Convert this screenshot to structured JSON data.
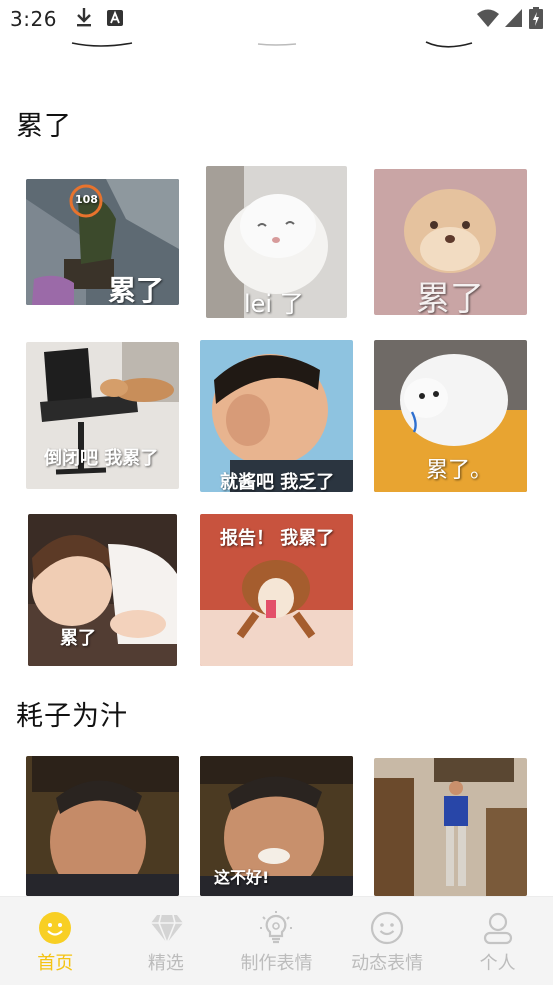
{
  "status_bar": {
    "time": "3:26",
    "icons": [
      "download-icon",
      "text-a-icon",
      "wifi-icon",
      "signal-icon",
      "battery-charging-icon"
    ]
  },
  "sections": [
    {
      "title": "累了",
      "stickers": [
        {
          "caption": "累了",
          "badge": "108",
          "scene": "game-character-sitting"
        },
        {
          "caption": "lei 了",
          "scene": "white-cat-leaning"
        },
        {
          "caption": "累了",
          "scene": "fluffy-dog-face"
        },
        {
          "caption": "倒闭吧 我累了",
          "scene": "cat-on-office-chair"
        },
        {
          "caption": "就酱吧 我乏了",
          "scene": "boy-rubbing-face"
        },
        {
          "caption": "累了。",
          "scene": "white-dog-crying"
        },
        {
          "caption": "累了",
          "scene": "baby-lying-down"
        },
        {
          "caption": "报告！ 我累了",
          "scene": "cartoon-mouse-sitting"
        }
      ]
    },
    {
      "title": "耗子为汁",
      "stickers": [
        {
          "caption": "",
          "scene": "man-smiling-closeup"
        },
        {
          "caption": "这不好!",
          "scene": "man-talking-closeup"
        },
        {
          "caption": "",
          "scene": "man-standing-in-room"
        }
      ]
    }
  ],
  "tab_bar": {
    "tabs": [
      {
        "label": "首页",
        "icon": "smiley-face-icon",
        "active": true
      },
      {
        "label": "精选",
        "icon": "diamond-icon",
        "active": false
      },
      {
        "label": "制作表情",
        "icon": "lightbulb-icon",
        "active": false
      },
      {
        "label": "动态表情",
        "icon": "smile-outline-icon",
        "active": false
      },
      {
        "label": "个人",
        "icon": "person-icon",
        "active": false
      }
    ]
  },
  "colors": {
    "accent": "#f4c312",
    "inactive": "#bcbcbc",
    "tab_bg": "#f4f4f4"
  }
}
